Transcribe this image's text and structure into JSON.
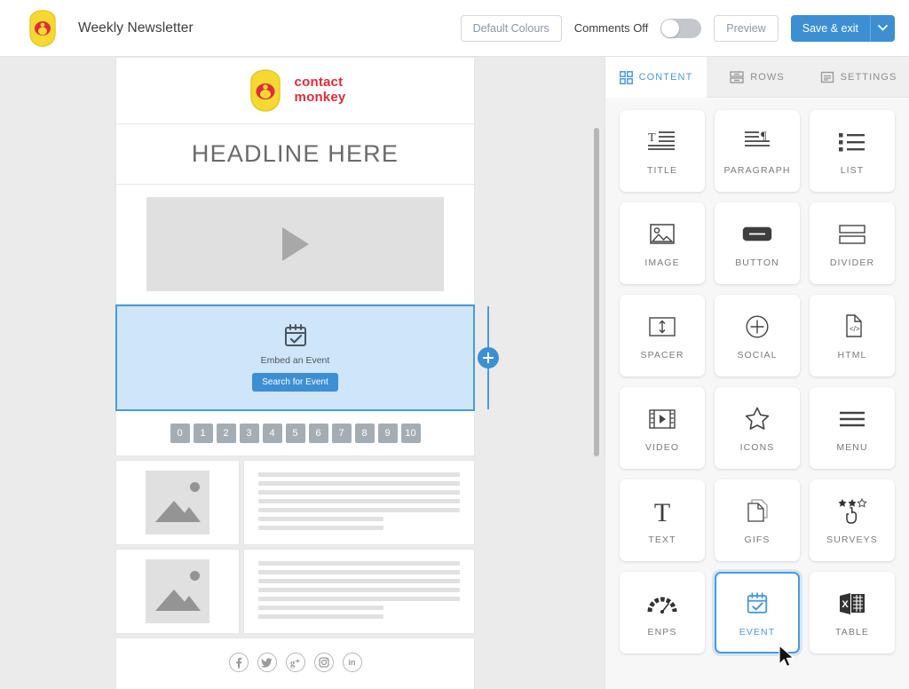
{
  "topbar": {
    "logo_icon": "contactmonkey-mark-icon",
    "doc_title": "Weekly Newsletter",
    "default_colours_label": "Default Colours",
    "comments_label": "Comments Off",
    "comments_toggle_state": "off",
    "preview_label": "Preview",
    "save_label": "Save & exit",
    "save_caret_icon": "chevron-down-icon",
    "accent_color": "#3d8fd4"
  },
  "email": {
    "logo": {
      "icon": "contactmonkey-monkey-icon",
      "word_line1": "contact",
      "word_line2": "monkey",
      "color": "#e02b3b"
    },
    "headline": "HEADLINE HERE",
    "video": {
      "icon": "play-triangle-icon"
    },
    "event_block": {
      "icon": "calendar-check-icon",
      "caption": "Embed an Event",
      "button_label": "Search for Event",
      "selected": true,
      "add_button_icon": "plus-circle-icon",
      "selection_color": "#4a9ade"
    },
    "nps_scale": [
      "0",
      "1",
      "2",
      "3",
      "4",
      "5",
      "6",
      "7",
      "8",
      "9",
      "10"
    ],
    "media_rows": [
      {
        "image_icon": "image-placeholder-icon",
        "text_lines": [
          100,
          100,
          100,
          100,
          100,
          72,
          72
        ]
      },
      {
        "image_icon": "image-placeholder-icon",
        "text_lines": [
          100,
          100,
          100,
          100,
          100,
          72,
          72
        ]
      }
    ],
    "social_icons": [
      {
        "name": "facebook-icon",
        "glyph": "f"
      },
      {
        "name": "twitter-icon",
        "glyph": "t"
      },
      {
        "name": "google-plus-icon",
        "glyph": "g"
      },
      {
        "name": "instagram-icon",
        "glyph": "i"
      },
      {
        "name": "linkedin-icon",
        "glyph": "in"
      }
    ]
  },
  "panel": {
    "tabs": [
      {
        "label": "CONTENT",
        "icon": "grid-squares-icon",
        "active": true
      },
      {
        "label": "ROWS",
        "icon": "rows-stack-icon",
        "active": false
      },
      {
        "label": "SETTINGS",
        "icon": "settings-panel-icon",
        "active": false
      }
    ],
    "tiles": [
      {
        "label": "TITLE",
        "icon": "title-text-icon",
        "selected": false
      },
      {
        "label": "PARAGRAPH",
        "icon": "paragraph-pilcrow-icon",
        "selected": false
      },
      {
        "label": "LIST",
        "icon": "bulleted-list-icon",
        "selected": false
      },
      {
        "label": "IMAGE",
        "icon": "image-icon",
        "selected": false
      },
      {
        "label": "BUTTON",
        "icon": "button-pill-icon",
        "selected": false
      },
      {
        "label": "DIVIDER",
        "icon": "divider-icon",
        "selected": false
      },
      {
        "label": "SPACER",
        "icon": "spacer-arrows-icon",
        "selected": false
      },
      {
        "label": "SOCIAL",
        "icon": "plus-circle-icon",
        "selected": false
      },
      {
        "label": "HTML",
        "icon": "code-file-icon",
        "selected": false
      },
      {
        "label": "VIDEO",
        "icon": "film-play-icon",
        "selected": false
      },
      {
        "label": "ICONS",
        "icon": "star-outline-icon",
        "selected": false
      },
      {
        "label": "MENU",
        "icon": "hamburger-menu-icon",
        "selected": false
      },
      {
        "label": "TEXT",
        "icon": "serif-t-icon",
        "selected": false
      },
      {
        "label": "GIFS",
        "icon": "stacked-pages-icon",
        "selected": false
      },
      {
        "label": "SURVEYS",
        "icon": "stars-hand-icon",
        "selected": false
      },
      {
        "label": "ENPS",
        "icon": "gauge-icon",
        "selected": false
      },
      {
        "label": "EVENT",
        "icon": "calendar-check-icon",
        "selected": true
      },
      {
        "label": "TABLE",
        "icon": "excel-table-icon",
        "selected": false
      }
    ]
  }
}
